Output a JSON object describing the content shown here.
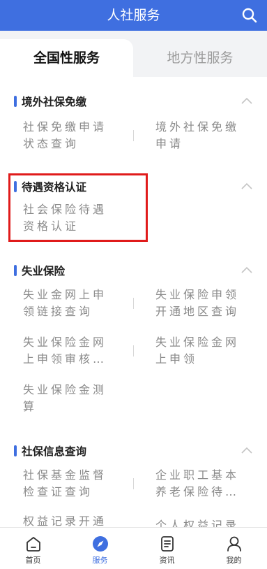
{
  "header": {
    "title": "人社服务",
    "search_icon": "search-icon"
  },
  "tabs": [
    {
      "label": "全国性服务",
      "active": true
    },
    {
      "label": "地方性服务",
      "active": false
    }
  ],
  "sections": [
    {
      "title": "境外社保免缴",
      "items": [
        {
          "lines": [
            "社保免缴申请",
            "状态查询"
          ]
        },
        {
          "lines": [
            "境外社保免缴",
            "申请"
          ]
        }
      ]
    },
    {
      "title": "待遇资格认证",
      "items": [
        {
          "lines": [
            "社会保险待遇",
            "资格认证"
          ]
        }
      ]
    },
    {
      "title": "失业保险",
      "items": [
        {
          "lines": [
            "失业金网上申",
            "领链接查询"
          ]
        },
        {
          "lines": [
            "失业保险申领",
            "开通地区查询"
          ]
        },
        {
          "lines": [
            "失业保险金网",
            "上申领审核…"
          ]
        },
        {
          "lines": [
            "失业保险金网",
            "上申领"
          ]
        },
        {
          "lines": [
            "失业保险金测",
            "算"
          ]
        }
      ]
    },
    {
      "title": "社保信息查询",
      "items": [
        {
          "lines": [
            "社保基金监督",
            "检查证查询"
          ]
        },
        {
          "lines": [
            "企业职工基本",
            "养老保险待…"
          ]
        },
        {
          "lines": [
            "权益记录开通",
            ""
          ]
        },
        {
          "lines": [
            "个人权益记录",
            ""
          ]
        }
      ]
    }
  ],
  "bottom_nav": [
    {
      "label": "首页",
      "icon": "home-icon",
      "active": false
    },
    {
      "label": "服务",
      "icon": "compass-icon",
      "active": true
    },
    {
      "label": "资讯",
      "icon": "news-icon",
      "active": false
    },
    {
      "label": "我的",
      "icon": "user-icon",
      "active": false
    }
  ],
  "colors": {
    "primary": "#3f6fe0",
    "highlight": "#e01b1b"
  }
}
